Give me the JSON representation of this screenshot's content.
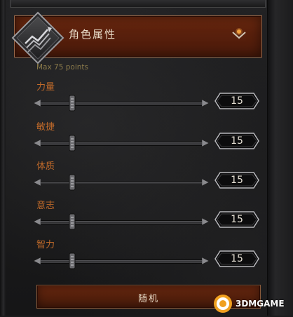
{
  "header": {
    "title": "角色属性",
    "emblem_icon": "chart-emblem-icon",
    "chevron_icon": "chevron-down-icon"
  },
  "hint": "Max 75 points",
  "stats": [
    {
      "label": "力量",
      "value": "15",
      "level": 0.2
    },
    {
      "label": "敏捷",
      "value": "15",
      "level": 0.2
    },
    {
      "label": "体质",
      "value": "15",
      "level": 0.2
    },
    {
      "label": "意志",
      "value": "15",
      "level": 0.2
    },
    {
      "label": "智力",
      "value": "15",
      "level": 0.2
    }
  ],
  "random_button": "随机",
  "watermark": "3DMGAME",
  "colors": {
    "accent_red": "#5a200c",
    "label_orange": "#c06a2a",
    "hint_gold": "#8a7a4a",
    "text_light": "#e9dcc8"
  }
}
